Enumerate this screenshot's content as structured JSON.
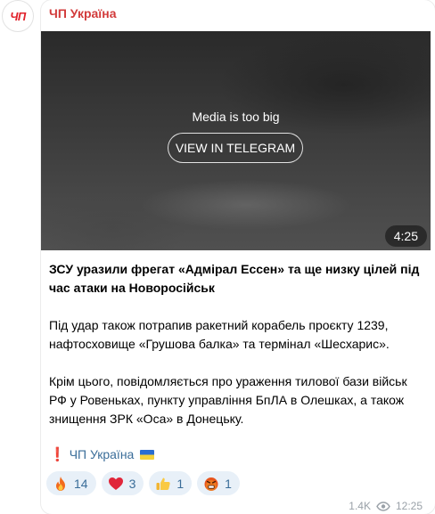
{
  "channel": {
    "avatar_text": "ЧП",
    "name": "ЧП Україна"
  },
  "media": {
    "message": "Media is too big",
    "button_label": "VIEW IN TELEGRAM",
    "duration": "4:25"
  },
  "post": {
    "headline": "ЗСУ уразили фрегат «Адмірал Ессен» та ще низку цілей під час атаки на Новоросійськ",
    "paragraph_1": "Під удар також потрапив ракетний корабель проєкту 1239, нафтосховище «Грушова балка» та термінал «Шесхарис».",
    "paragraph_2": "Крім цього, повідомляється про ураження тилової бази військ РФ у Ровеньках, пункту управління БпЛА в Олешках, а також знищення ЗРК «Оса» в Донецьку.",
    "signature_mark": "❗",
    "signature_link": "ЧП Україна"
  },
  "reactions": [
    {
      "icon": "fire-icon",
      "count": "14"
    },
    {
      "icon": "heart-icon",
      "count": "3"
    },
    {
      "icon": "thumbs-up-icon",
      "count": "1"
    },
    {
      "icon": "angry-face-icon",
      "count": "1"
    }
  ],
  "footer": {
    "views": "1.4K",
    "time": "12:25"
  },
  "colors": {
    "channel_name": "#d23b3b",
    "link": "#3a6d99",
    "reaction_bg": "#e8f0f8"
  }
}
